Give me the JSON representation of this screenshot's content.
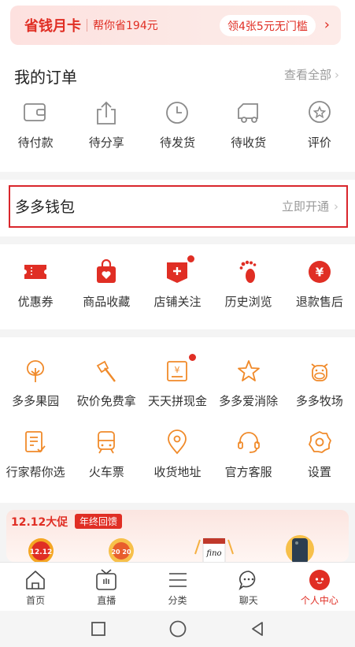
{
  "save_card": {
    "title": "省钱月卡",
    "subtitle": "帮你省194元",
    "pill": "领4张5元无门槛",
    "arrow": "›"
  },
  "orders": {
    "title": "我的订单",
    "view_all": "查看全部",
    "items": [
      {
        "label": "待付款",
        "icon": "wallet-icon"
      },
      {
        "label": "待分享",
        "icon": "share-icon"
      },
      {
        "label": "待发货",
        "icon": "clock-icon"
      },
      {
        "label": "待收货",
        "icon": "truck-icon"
      },
      {
        "label": "评价",
        "icon": "review-star-icon"
      }
    ]
  },
  "wallet": {
    "title": "多多钱包",
    "action": "立即开通"
  },
  "tools_primary": [
    {
      "label": "优惠券",
      "icon": "coupon-icon"
    },
    {
      "label": "商品收藏",
      "icon": "favorite-bag-icon"
    },
    {
      "label": "店铺关注",
      "icon": "store-follow-icon",
      "badge": true
    },
    {
      "label": "历史浏览",
      "icon": "footprint-icon"
    },
    {
      "label": "退款售后",
      "icon": "refund-icon"
    }
  ],
  "tools_secondary": [
    {
      "label": "多多果园",
      "icon": "tree-icon"
    },
    {
      "label": "砍价免费拿",
      "icon": "axe-icon"
    },
    {
      "label": "天天拼现金",
      "icon": "cash-icon",
      "badge": true
    },
    {
      "label": "多多爱消除",
      "icon": "star-icon"
    },
    {
      "label": "多多牧场",
      "icon": "cow-icon"
    },
    {
      "label": "行家帮你选",
      "icon": "checklist-icon"
    },
    {
      "label": "火车票",
      "icon": "train-icon"
    },
    {
      "label": "收货地址",
      "icon": "location-icon"
    },
    {
      "label": "官方客服",
      "icon": "headset-icon"
    },
    {
      "label": "设置",
      "icon": "gear-icon"
    }
  ],
  "promo": {
    "title": "12.12大促",
    "tag": "年终回馈",
    "badge1": "12.12",
    "badge2": "20 20",
    "product": "fino"
  },
  "tabbar": [
    {
      "label": "首页",
      "icon": "home-icon"
    },
    {
      "label": "直播",
      "icon": "tv-icon"
    },
    {
      "label": "分类",
      "icon": "list-icon"
    },
    {
      "label": "聊天",
      "icon": "chat-icon"
    },
    {
      "label": "个人中心",
      "icon": "profile-icon",
      "active": true
    }
  ],
  "colors": {
    "brand": "#e02e24",
    "orange": "#f08a2a",
    "gray_icon": "#8a8a8a"
  }
}
